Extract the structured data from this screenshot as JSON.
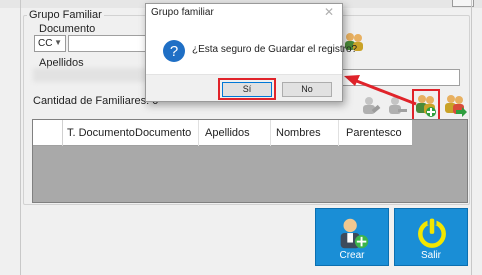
{
  "form": {
    "group_title": "Grupo Familiar",
    "documento_label": "Documento",
    "doc_type": "CC",
    "apellidos_label": "Apellidos",
    "cantidad_label": "Cantidad de Familiares: 0"
  },
  "grid": {
    "columns": [
      "T. Documento",
      "Documento",
      "Apellidos",
      "Nombres",
      "Parentesco"
    ]
  },
  "buttons": {
    "crear": "Crear",
    "salir": "Salir"
  },
  "dialog": {
    "title": "Grupo familiar",
    "message": "¿Esta seguro de Guardar el registro?",
    "yes": "Sí",
    "no": "No",
    "close": "✕"
  },
  "colors": {
    "accent_blue": "#1a8ed6",
    "highlight_red": "#e0232a",
    "grid_bg": "#a9a9a9"
  }
}
